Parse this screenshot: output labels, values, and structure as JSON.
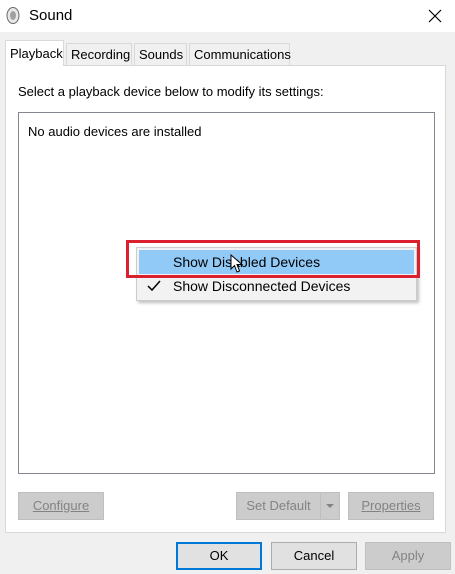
{
  "window": {
    "title": "Sound",
    "close_icon": "close-icon",
    "app_icon": "speaker-icon"
  },
  "tabs": [
    {
      "label": "Playback",
      "active": true
    },
    {
      "label": "Recording",
      "active": false
    },
    {
      "label": "Sounds",
      "active": false
    },
    {
      "label": "Communications",
      "active": false
    }
  ],
  "playback": {
    "instruction": "Select a playback device below to modify its settings:",
    "empty_message": "No audio devices are installed"
  },
  "context_menu": {
    "items": [
      {
        "label": "Show Disabled Devices",
        "checked": false,
        "highlighted": true
      },
      {
        "label": "Show Disconnected Devices",
        "checked": true,
        "highlighted": false
      }
    ]
  },
  "panel_buttons": {
    "configure": {
      "label": "Configure",
      "enabled": false
    },
    "set_default": {
      "label": "Set Default",
      "enabled": false
    },
    "properties": {
      "label": "Properties",
      "enabled": false
    }
  },
  "dialog_buttons": {
    "ok": "OK",
    "cancel": "Cancel",
    "apply": "Apply"
  },
  "colors": {
    "highlight": "#91c9f7",
    "annotation": "#d9202c",
    "focus_border": "#0078d7"
  }
}
